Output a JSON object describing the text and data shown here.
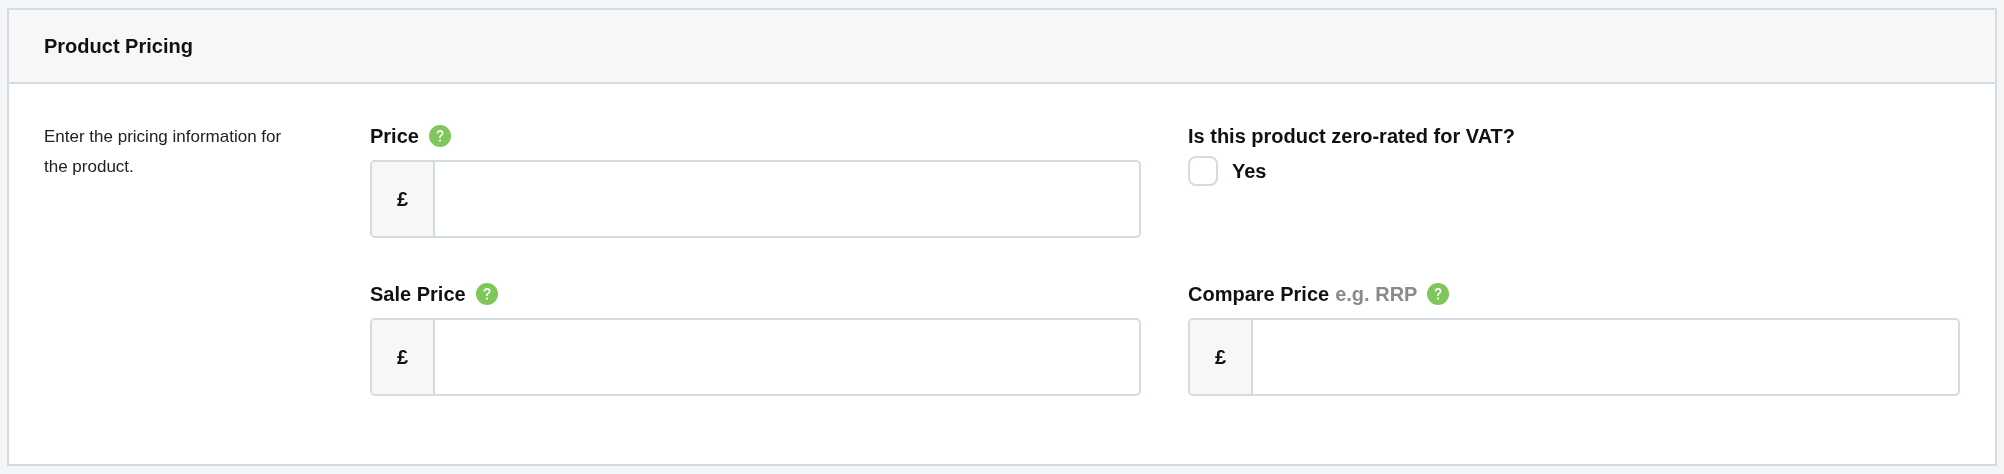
{
  "panel": {
    "title": "Product Pricing",
    "description": "Enter the pricing information for the product."
  },
  "fields": [
    {
      "kind": "money",
      "label": "Price",
      "help": true,
      "prefix": "£"
    },
    {
      "kind": "checkbox",
      "label": "Is this product zero-rated for VAT?",
      "help": false,
      "option": "Yes",
      "checked": false
    },
    {
      "kind": "money",
      "label": "Sale Price",
      "help": true,
      "prefix": "£"
    },
    {
      "kind": "money",
      "label": "Compare Price",
      "hint": "e.g. RRP",
      "help": true,
      "prefix": "£"
    }
  ]
}
